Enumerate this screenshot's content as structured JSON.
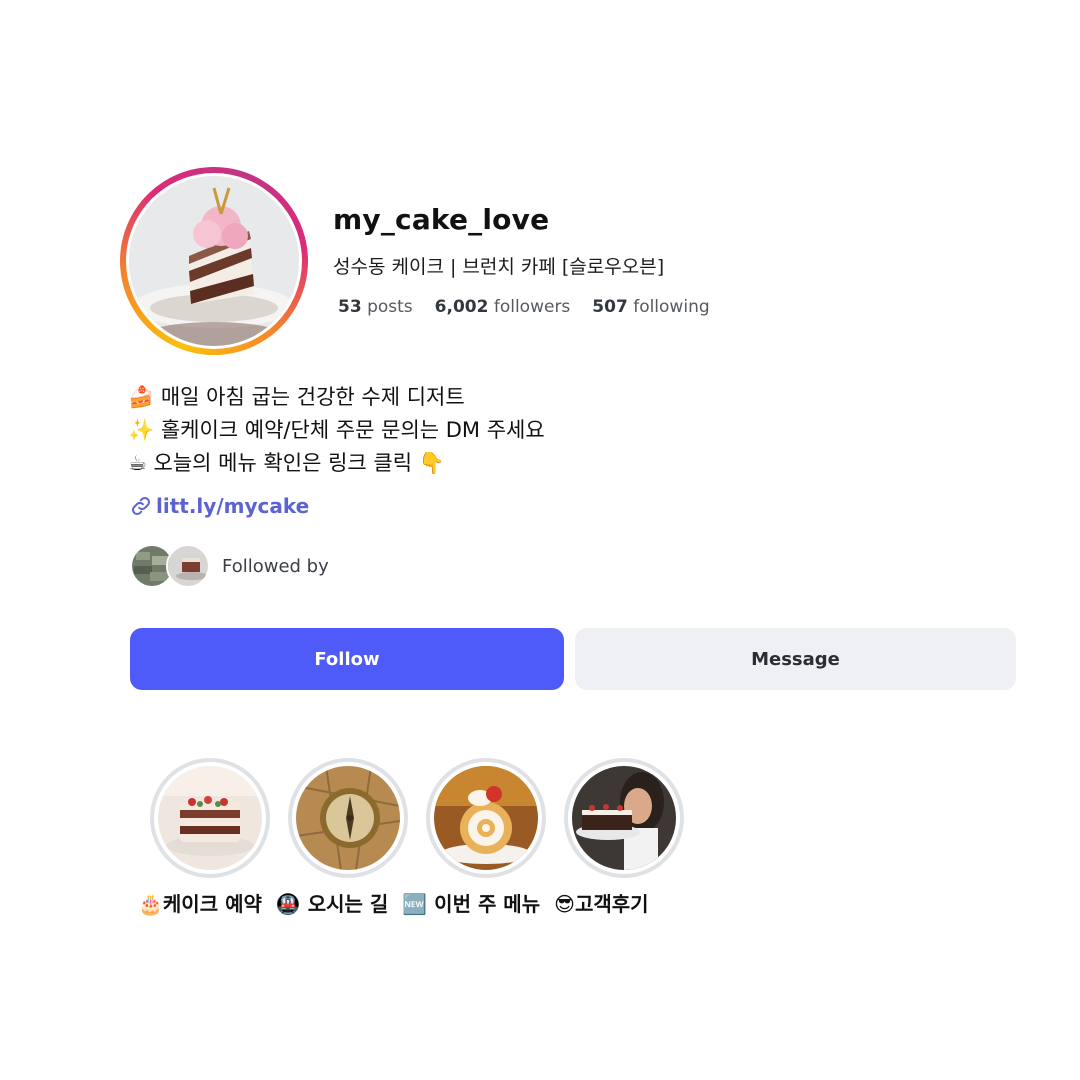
{
  "profile": {
    "username": "my_cake_love",
    "subtitle": "성수동 케이크 | 브런치 카페 [슬로우오븐]",
    "stats": {
      "posts_count": "53",
      "posts_label": "posts",
      "followers_count": "6,002",
      "followers_label": "followers",
      "following_count": "507",
      "following_label": "following"
    },
    "bio": [
      "🍰 매일 아침 굽는 건강한 수제 디저트",
      "✨ 홀케이크 예약/단체 주문 문의는 DM 주세요",
      "☕ 오늘의 메뉴 확인은 링크 클릭 👇"
    ],
    "link": "litt.ly/mycake",
    "followed_by_label": "Followed by"
  },
  "buttons": {
    "follow_label": "Follow",
    "message_label": "Message"
  },
  "highlights": [
    {
      "label": "🎂케이크 예약",
      "icon": "cake-photo"
    },
    {
      "label": "🚇 오시는 길",
      "icon": "compass-photo"
    },
    {
      "label": "🆕 이번 주 메뉴",
      "icon": "roll-cake-photo"
    },
    {
      "label": "😎고객후기",
      "icon": "customer-photo"
    }
  ],
  "colors": {
    "follow_button": "#4f5bf8",
    "message_button": "#eff0f4",
    "link": "#5b63d3",
    "ring_gradient": [
      "#f9c20a",
      "#f58529",
      "#dd2a7b",
      "#c13584"
    ]
  }
}
